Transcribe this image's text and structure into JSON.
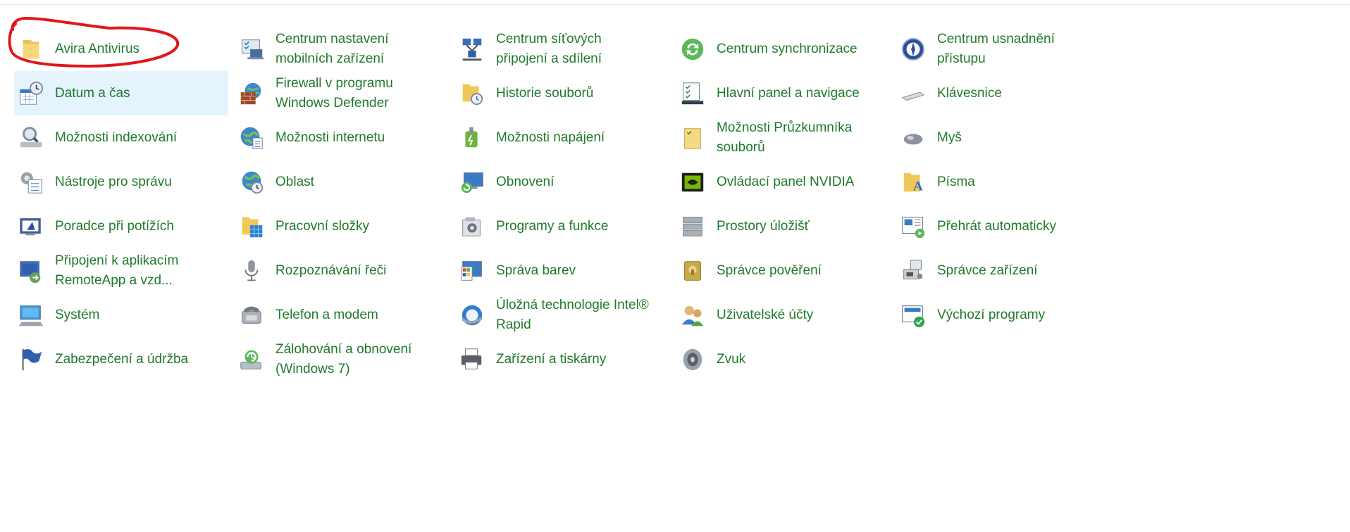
{
  "colors": {
    "link": "#1f7a2a",
    "hover_bg": "#e5f3fd",
    "annotation": "#e0171b"
  },
  "items": [
    {
      "label": "Avira Antivirus",
      "icon": "folder-icon"
    },
    {
      "label": "Centrum nastavení\nmobilních zařízení",
      "icon": "mobility-center-icon"
    },
    {
      "label": "Centrum síťových\npřipojení a sdílení",
      "icon": "network-center-icon"
    },
    {
      "label": "Centrum synchronizace",
      "icon": "sync-center-icon"
    },
    {
      "label": "Centrum usnadnění\npřístupu",
      "icon": "ease-of-access-icon"
    },
    {
      "label": "Datum a čas",
      "icon": "date-time-icon"
    },
    {
      "label": "Firewall v programu\nWindows Defender",
      "icon": "firewall-icon"
    },
    {
      "label": "Historie souborů",
      "icon": "file-history-icon"
    },
    {
      "label": "Hlavní panel a navigace",
      "icon": "taskbar-icon"
    },
    {
      "label": "Klávesnice",
      "icon": "keyboard-icon"
    },
    {
      "label": "Možnosti indexování",
      "icon": "indexing-icon"
    },
    {
      "label": "Možnosti internetu",
      "icon": "internet-options-icon"
    },
    {
      "label": "Možnosti napájení",
      "icon": "power-options-icon"
    },
    {
      "label": "Možnosti Průzkumníka\nsouborů",
      "icon": "explorer-options-icon"
    },
    {
      "label": "Myš",
      "icon": "mouse-icon"
    },
    {
      "label": "Nástroje pro správu",
      "icon": "admin-tools-icon"
    },
    {
      "label": "Oblast",
      "icon": "region-icon"
    },
    {
      "label": "Obnovení",
      "icon": "recovery-icon"
    },
    {
      "label": "Ovládací panel NVIDIA",
      "icon": "nvidia-icon"
    },
    {
      "label": "Písma",
      "icon": "fonts-icon"
    },
    {
      "label": "Poradce při potížích",
      "icon": "troubleshooting-icon"
    },
    {
      "label": "Pracovní složky",
      "icon": "work-folders-icon"
    },
    {
      "label": "Programy a funkce",
      "icon": "programs-icon"
    },
    {
      "label": "Prostory úložišť",
      "icon": "storage-spaces-icon"
    },
    {
      "label": "Přehrát automaticky",
      "icon": "autoplay-icon"
    },
    {
      "label": "Připojení k aplikacím\nRemoteApp a vzd...",
      "icon": "remoteapp-icon"
    },
    {
      "label": "Rozpoznávání řeči",
      "icon": "microphone-icon"
    },
    {
      "label": "Správa barev",
      "icon": "color-management-icon"
    },
    {
      "label": "Správce pověření",
      "icon": "credential-manager-icon"
    },
    {
      "label": "Správce zařízení",
      "icon": "device-manager-icon"
    },
    {
      "label": "Systém",
      "icon": "system-icon"
    },
    {
      "label": "Telefon a modem",
      "icon": "phone-modem-icon"
    },
    {
      "label": "Úložná technologie Intel®\nRapid",
      "icon": "intel-rapid-storage-icon"
    },
    {
      "label": "Uživatelské účty",
      "icon": "user-accounts-icon"
    },
    {
      "label": "Výchozí programy",
      "icon": "default-programs-icon"
    },
    {
      "label": "Zabezpečení a údržba",
      "icon": "security-flag-icon"
    },
    {
      "label": "Zálohování a obnovení\n(Windows 7)",
      "icon": "backup-restore-icon"
    },
    {
      "label": "Zařízení a tiskárny",
      "icon": "printer-icon"
    },
    {
      "label": "Zvuk",
      "icon": "speaker-icon"
    }
  ]
}
